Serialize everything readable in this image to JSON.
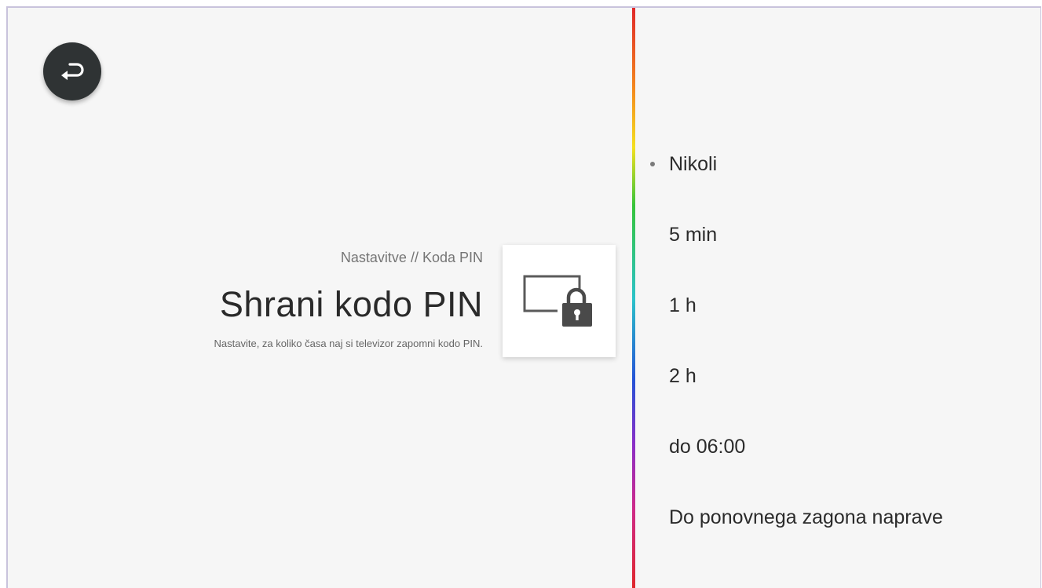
{
  "header": {
    "breadcrumb": "Nastavitve // Koda PIN",
    "title": "Shrani kodo PIN",
    "subtitle": "Nastavite, za koliko časa naj si televizor zapomni kodo PIN."
  },
  "back_button": {
    "icon": "return-arrow-icon"
  },
  "settings_icon": {
    "icon": "screen-lock-icon"
  },
  "options": [
    {
      "label": "Nikoli",
      "selected": true
    },
    {
      "label": "5 min",
      "selected": false
    },
    {
      "label": "1 h",
      "selected": false
    },
    {
      "label": "2 h",
      "selected": false
    },
    {
      "label": "do 06:00",
      "selected": false
    },
    {
      "label": "Do ponovnega zagona naprave",
      "selected": false
    }
  ],
  "colors": {
    "background": "#f6f6f6",
    "back_button_bg": "#2f3334",
    "text_primary": "#2b2b2b",
    "text_secondary": "#757575"
  }
}
